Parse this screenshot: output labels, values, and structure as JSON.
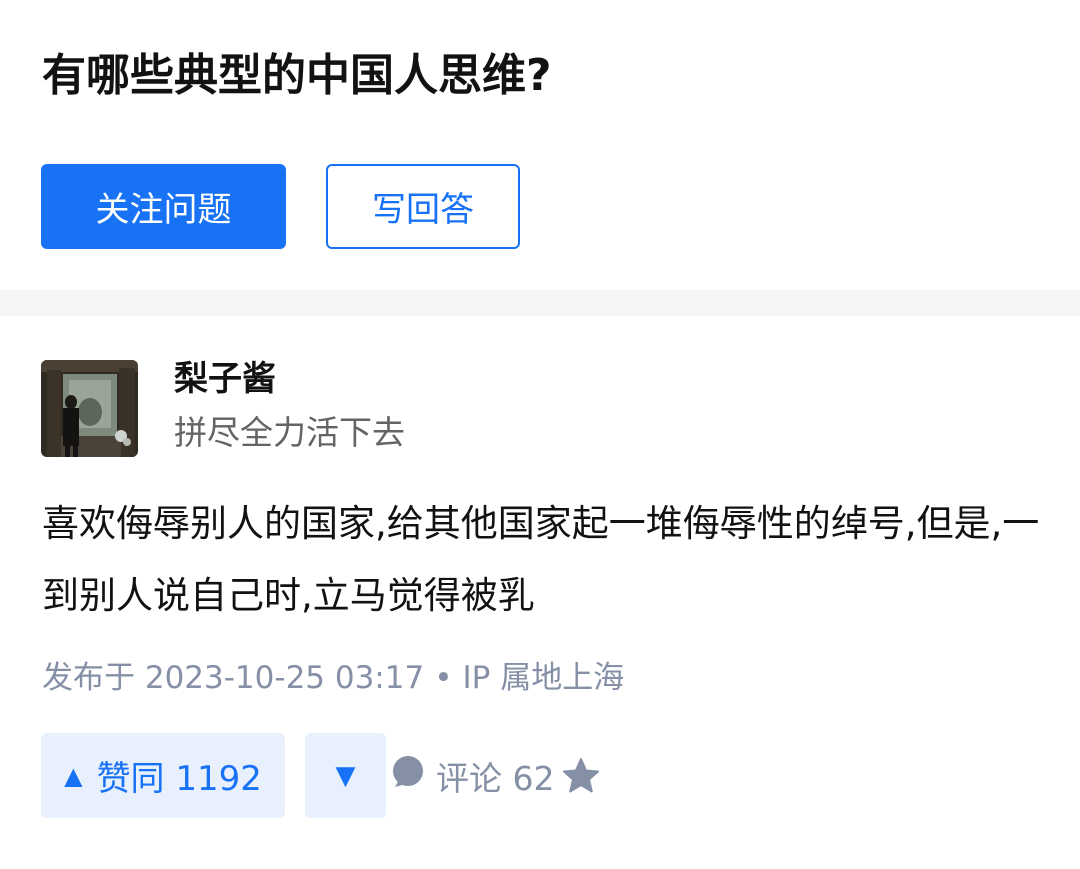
{
  "question": {
    "title": "有哪些典型的中国人思维?",
    "follow_label": "关注问题",
    "answer_label": "写回答"
  },
  "answer": {
    "author": {
      "name": "梨子酱",
      "bio": "拼尽全力活下去"
    },
    "content": "喜欢侮辱别人的国家,给其他国家起一堆侮辱性的绰号,但是,一到别人说自己时,立马觉得被乳",
    "meta": {
      "published": "发布于 2023-10-25 03:17",
      "separator": "•",
      "ip": "IP 属地上海"
    },
    "actions": {
      "upvote_icon": "▲",
      "upvote_label": "赞同 1192",
      "downvote_icon": "▼",
      "comment_label": "评论 62",
      "comment_icon": "comment-bubble-icon",
      "favorite_icon": "star-icon"
    }
  },
  "colors": {
    "brand_blue": "#1772f6",
    "light_blue_bg": "#e8f0fd",
    "meta_gray": "#8590a6",
    "divider": "#f6f6f6"
  }
}
